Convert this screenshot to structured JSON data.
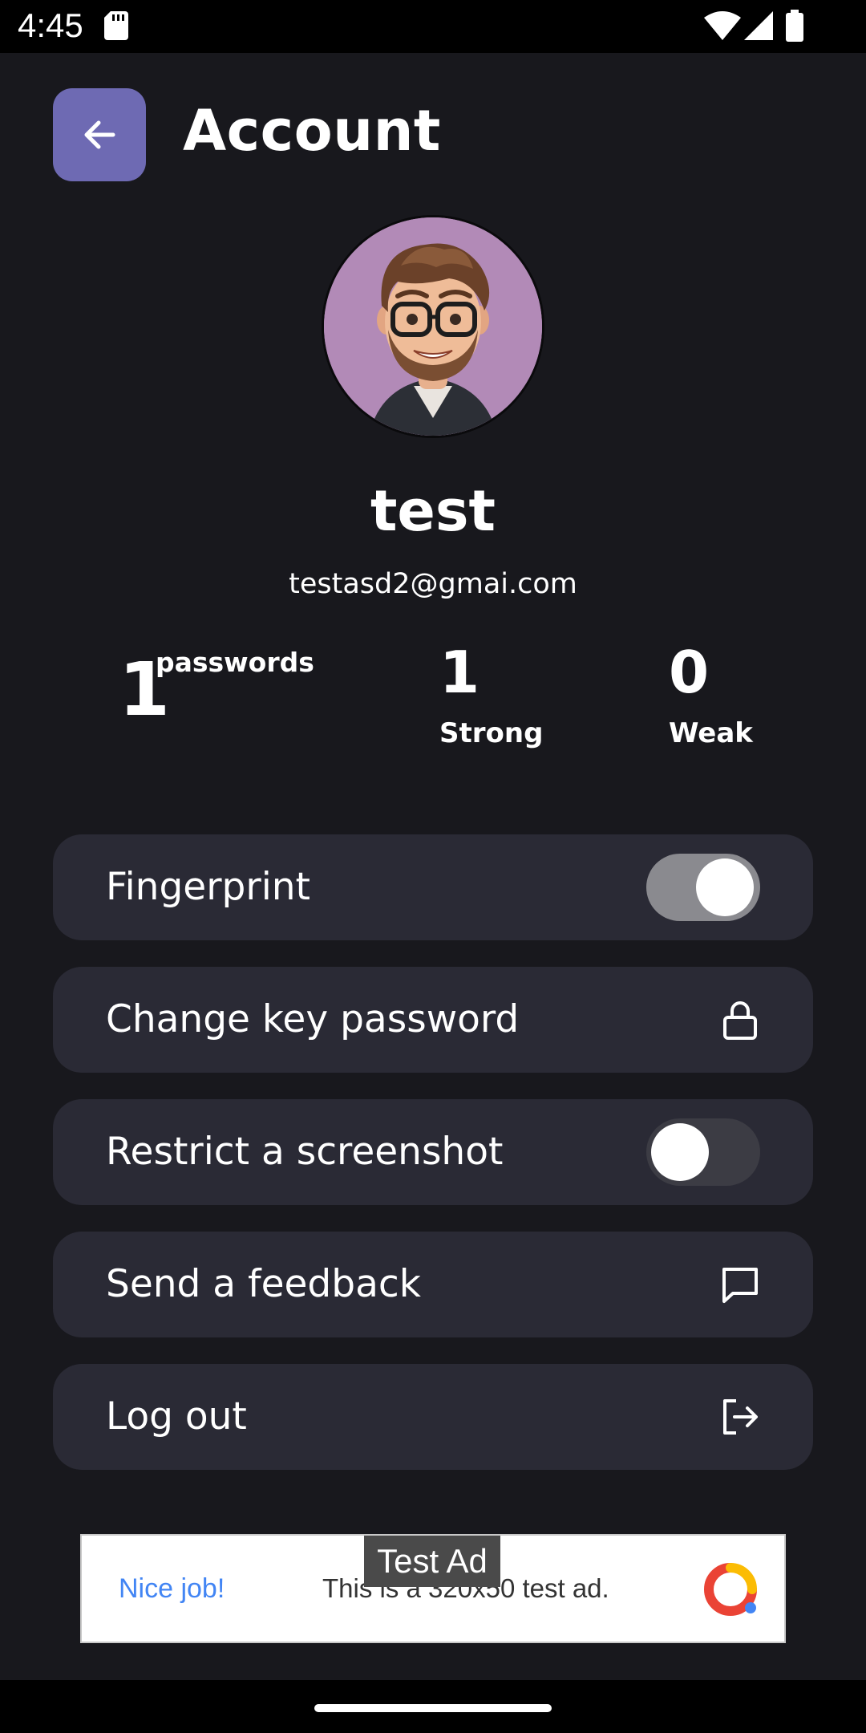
{
  "status_bar": {
    "time": "4:45",
    "icons": [
      "sd-card-icon",
      "wifi-icon",
      "signal-icon",
      "battery-icon"
    ]
  },
  "header": {
    "title": "Account",
    "back_icon": "arrow-left-icon"
  },
  "profile": {
    "name": "test",
    "email": "testasd2@gmai.com",
    "avatar": "cartoon-man-with-glasses-avatar"
  },
  "stats": {
    "total": {
      "value": "1",
      "label": "passwords"
    },
    "strong": {
      "value": "1",
      "label": "Strong"
    },
    "weak": {
      "value": "0",
      "label": "Weak"
    }
  },
  "settings": {
    "fingerprint": {
      "label": "Fingerprint",
      "enabled": true
    },
    "change_key_password": {
      "label": "Change key password",
      "icon": "lock-icon"
    },
    "restrict_screenshot": {
      "label": "Restrict a screenshot",
      "enabled": false
    },
    "send_feedback": {
      "label": "Send a feedback",
      "icon": "chat-bubble-icon"
    },
    "log_out": {
      "label": "Log out",
      "icon": "logout-icon"
    }
  },
  "ad": {
    "tag": "Test Ad",
    "headline": "Nice job!",
    "body": "This is a 320x50 test ad.",
    "logo": "admob-logo-icon"
  },
  "colors": {
    "background": "#18181d",
    "row_background": "#2a2a35",
    "accent": "#6e6ab3",
    "avatar_background": "#b28ab7"
  }
}
